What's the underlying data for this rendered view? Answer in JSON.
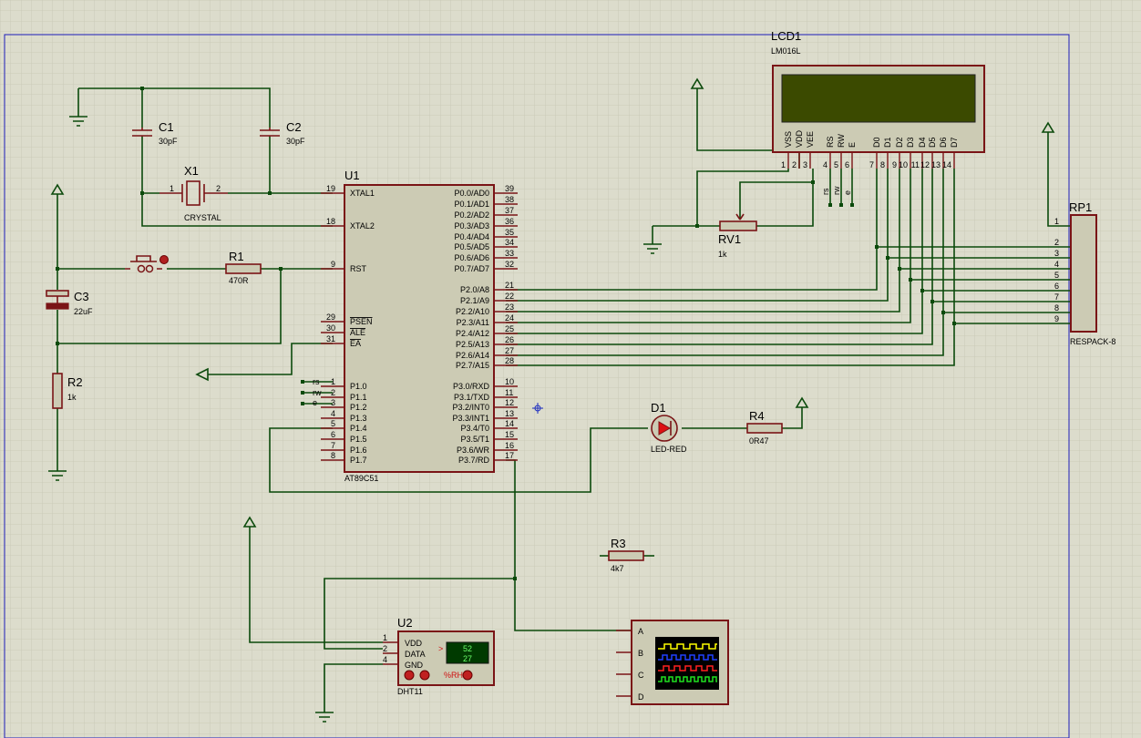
{
  "colors": {
    "sheet": "#dcdccc",
    "grid": "#c8c8b8",
    "border": "#1d1db8",
    "wire": "#0b4a0b",
    "component": "#7a1416",
    "body": "#cccbb4",
    "lcd": "#3b4a00"
  },
  "lcd": {
    "ref": "LCD1",
    "model": "LM016L",
    "pin_names": [
      "VSS",
      "VDD",
      "VEE",
      "RS",
      "RW",
      "E",
      "D0",
      "D1",
      "D2",
      "D3",
      "D4",
      "D5",
      "D6",
      "D7"
    ],
    "pin_numbers": [
      "1",
      "2",
      "3",
      "4",
      "5",
      "6",
      "7",
      "8",
      "9",
      "10",
      "11",
      "12",
      "13",
      "14"
    ],
    "control_labels": [
      "rs",
      "rw",
      "e"
    ]
  },
  "mcu": {
    "ref": "U1",
    "model": "AT89C51",
    "left_pins": [
      {
        "num": "19",
        "name": "XTAL1"
      },
      {
        "num": "18",
        "name": "XTAL2"
      },
      {
        "num": "9",
        "name": "RST"
      },
      {
        "num": "29",
        "name": "PSEN"
      },
      {
        "num": "30",
        "name": "ALE"
      },
      {
        "num": "31",
        "name": "EA"
      },
      {
        "num": "1",
        "name": "P1.0",
        "net": "rs"
      },
      {
        "num": "2",
        "name": "P1.1",
        "net": "rw"
      },
      {
        "num": "3",
        "name": "P1.2",
        "net": "e"
      },
      {
        "num": "4",
        "name": "P1.3"
      },
      {
        "num": "5",
        "name": "P1.4"
      },
      {
        "num": "6",
        "name": "P1.5"
      },
      {
        "num": "7",
        "name": "P1.6"
      },
      {
        "num": "8",
        "name": "P1.7"
      }
    ],
    "right_pins": [
      {
        "num": "39",
        "name": "P0.0/AD0"
      },
      {
        "num": "38",
        "name": "P0.1/AD1"
      },
      {
        "num": "37",
        "name": "P0.2/AD2"
      },
      {
        "num": "36",
        "name": "P0.3/AD3"
      },
      {
        "num": "35",
        "name": "P0.4/AD4"
      },
      {
        "num": "34",
        "name": "P0.5/AD5"
      },
      {
        "num": "33",
        "name": "P0.6/AD6"
      },
      {
        "num": "32",
        "name": "P0.7/AD7"
      },
      {
        "num": "21",
        "name": "P2.0/A8"
      },
      {
        "num": "22",
        "name": "P2.1/A9"
      },
      {
        "num": "23",
        "name": "P2.2/A10"
      },
      {
        "num": "24",
        "name": "P2.3/A11"
      },
      {
        "num": "25",
        "name": "P2.4/A12"
      },
      {
        "num": "26",
        "name": "P2.5/A13"
      },
      {
        "num": "27",
        "name": "P2.6/A14"
      },
      {
        "num": "28",
        "name": "P2.7/A15"
      },
      {
        "num": "10",
        "name": "P3.0/RXD"
      },
      {
        "num": "11",
        "name": "P3.1/TXD"
      },
      {
        "num": "12",
        "name": "P3.2/INT0"
      },
      {
        "num": "13",
        "name": "P3.3/INT1"
      },
      {
        "num": "14",
        "name": "P3.4/T0"
      },
      {
        "num": "15",
        "name": "P3.5/T1"
      },
      {
        "num": "16",
        "name": "P3.6/WR"
      },
      {
        "num": "17",
        "name": "P3.7/RD"
      }
    ]
  },
  "parts": {
    "c1": {
      "ref": "C1",
      "value": "30pF"
    },
    "c2": {
      "ref": "C2",
      "value": "30pF"
    },
    "c3": {
      "ref": "C3",
      "value": "22uF"
    },
    "x1": {
      "ref": "X1",
      "value": "CRYSTAL",
      "pin1": "1",
      "pin2": "2"
    },
    "r1": {
      "ref": "R1",
      "value": "470R"
    },
    "r2": {
      "ref": "R2",
      "value": "1k"
    },
    "r3": {
      "ref": "R3",
      "value": "4k7"
    },
    "r4": {
      "ref": "R4",
      "value": "0R47"
    },
    "rv1": {
      "ref": "RV1",
      "value": "1k"
    },
    "d1": {
      "ref": "D1",
      "value": "LED-RED"
    },
    "rp1": {
      "ref": "RP1",
      "value": "RESPACK-8",
      "pins": [
        "1",
        "2",
        "3",
        "4",
        "5",
        "6",
        "7",
        "8",
        "9"
      ]
    },
    "u2": {
      "ref": "U2",
      "model": "DHT11",
      "pins": [
        {
          "num": "1",
          "name": "VDD"
        },
        {
          "num": "2",
          "name": "DATA"
        },
        {
          "num": "4",
          "name": "GND"
        }
      ],
      "humidity": "52",
      "temperature": "27",
      "unit_label": "%RH",
      "arrow": ">"
    },
    "scope": {
      "channels": [
        "A",
        "B",
        "C",
        "D"
      ],
      "trace_colors": [
        "#ffff00",
        "#2040ff",
        "#ff2020",
        "#20e020"
      ]
    }
  }
}
